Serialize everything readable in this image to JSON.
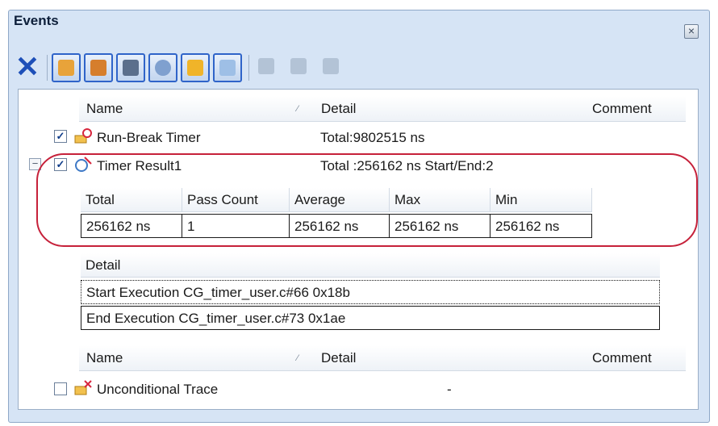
{
  "window": {
    "title": "Events"
  },
  "toolbar": {
    "buttons": [
      {
        "icon": "delete-icon"
      },
      {
        "icon": "hardware-break-icon"
      },
      {
        "icon": "software-break-icon"
      },
      {
        "icon": "trace-icon"
      },
      {
        "icon": "timer-icon"
      },
      {
        "icon": "action-icon"
      },
      {
        "icon": "window-icon"
      },
      {
        "icon": "edit-disabled-icon"
      },
      {
        "icon": "copy-disabled-icon"
      },
      {
        "icon": "paste-disabled-icon"
      }
    ]
  },
  "list_header": {
    "name": "Name",
    "detail": "Detail",
    "comment": "Comment"
  },
  "events": [
    {
      "name": "Run-Break Timer",
      "detail": "Total:9802515 ns",
      "checked": true,
      "icon": "run-break-timer-icon"
    },
    {
      "name": "Timer Result1",
      "detail": "Total :256162 ns  Start/End:2",
      "checked": true,
      "icon": "timer-result-icon"
    },
    {
      "name": "Unconditional Trace",
      "detail": "-",
      "checked": false,
      "icon": "unconditional-trace-icon"
    }
  ],
  "result_table": {
    "headers": [
      "Total",
      "Pass Count",
      "Average",
      "Max",
      "Min"
    ],
    "values": [
      "256162 ns",
      "1",
      "256162 ns",
      "256162 ns",
      "256162 ns"
    ]
  },
  "detail_table": {
    "header": "Detail",
    "rows": [
      "Start Execution CG_timer_user.c#66 0x18b",
      "End Execution CG_timer_user.c#73 0x1ae"
    ]
  },
  "colors": {
    "highlight": "#c6213a",
    "accent": "#2f64c9"
  }
}
